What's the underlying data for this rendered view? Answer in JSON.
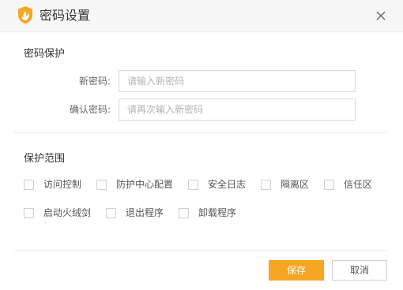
{
  "window": {
    "title": "密码设置",
    "logo_icon": "flame-shield-icon",
    "close_icon": "close-icon",
    "accent_color": "#f5a623"
  },
  "password_section": {
    "title": "密码保护",
    "new_password": {
      "label": "新密码:",
      "placeholder": "请输入新密码",
      "value": ""
    },
    "confirm_password": {
      "label": "确认密码:",
      "placeholder": "请再次输入新密码",
      "value": ""
    }
  },
  "scope_section": {
    "title": "保护范围",
    "options": [
      {
        "label": "访问控制",
        "checked": false
      },
      {
        "label": "防护中心配置",
        "checked": false
      },
      {
        "label": "安全日志",
        "checked": false
      },
      {
        "label": "隔离区",
        "checked": false
      },
      {
        "label": "信任区",
        "checked": false
      },
      {
        "label": "启动火绒剑",
        "checked": false
      },
      {
        "label": "退出程序",
        "checked": false
      },
      {
        "label": "卸载程序",
        "checked": false
      }
    ]
  },
  "footer": {
    "save_label": "保存",
    "cancel_label": "取消"
  }
}
